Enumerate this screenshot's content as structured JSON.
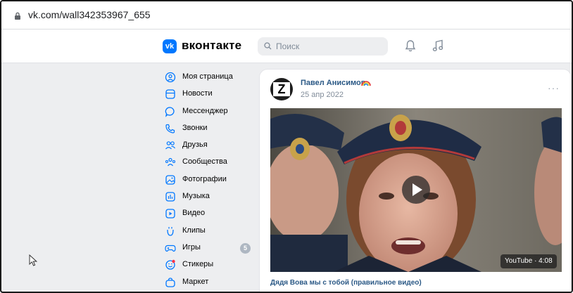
{
  "browser": {
    "url": "vk.com/wall342353967_655"
  },
  "header": {
    "logo_mark": "vk",
    "logo_text": "вконтакте",
    "search_placeholder": "Поиск",
    "icons": [
      "bell-icon",
      "music-icon"
    ]
  },
  "menu": {
    "items": [
      {
        "label": "Моя страница",
        "icon": "user-circle-icon"
      },
      {
        "label": "Новости",
        "icon": "news-icon"
      },
      {
        "label": "Мессенджер",
        "icon": "message-icon"
      },
      {
        "label": "Звонки",
        "icon": "phone-icon"
      },
      {
        "label": "Друзья",
        "icon": "friends-icon"
      },
      {
        "label": "Сообщества",
        "icon": "communities-icon"
      },
      {
        "label": "Фотографии",
        "icon": "photos-icon"
      },
      {
        "label": "Музыка",
        "icon": "music-icon"
      },
      {
        "label": "Видео",
        "icon": "video-icon"
      },
      {
        "label": "Клипы",
        "icon": "clips-icon"
      },
      {
        "label": "Игры",
        "icon": "gamepad-icon",
        "badge": "5"
      },
      {
        "label": "Стикеры",
        "icon": "sticker-icon"
      },
      {
        "label": "Маркет",
        "icon": "market-icon"
      }
    ]
  },
  "post": {
    "author": "Павел Анисимов",
    "date": "25 апр 2022",
    "avatar_letter": "Z",
    "more": "···",
    "video": {
      "duration": "YouTube · 4:08",
      "title": "Дядя Вова мы с тобой (правильное видео)"
    }
  },
  "colors": {
    "accent": "#0077ff",
    "link": "#2a5885",
    "bg": "#edeef0"
  }
}
